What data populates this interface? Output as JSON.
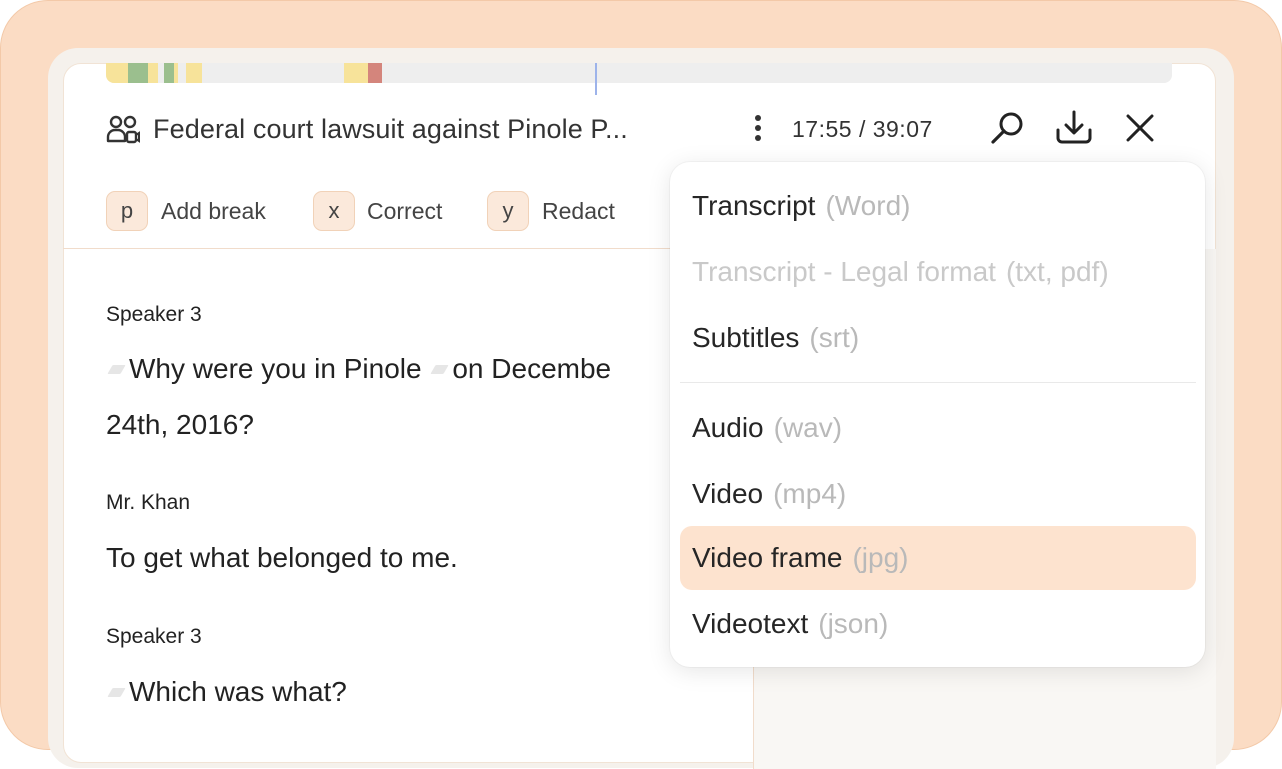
{
  "header": {
    "title": "Federal court lawsuit against Pinole P...",
    "time": "17:55 / 39:07",
    "icons": [
      "people-icon",
      "more-icon",
      "search-icon",
      "download-icon",
      "close-icon"
    ]
  },
  "shortcuts": [
    {
      "key": "p",
      "label": "Add break"
    },
    {
      "key": "x",
      "label": "Correct"
    },
    {
      "key": "y",
      "label": "Redact"
    }
  ],
  "transcript": [
    {
      "speaker": "Speaker 3",
      "lines": [
        "Why were you in Pinole",
        "on Decembe",
        "24th, 2016?"
      ]
    },
    {
      "speaker": "Mr. Khan",
      "lines": [
        "To get what belonged to me."
      ]
    },
    {
      "speaker": "Speaker 3",
      "lines": [
        "Which was what?"
      ]
    }
  ],
  "download_menu": {
    "items": [
      {
        "label": "Transcript",
        "format": "(Word)"
      },
      {
        "label": "Transcript - Legal format",
        "format": "(txt, pdf)",
        "disabled": true
      },
      {
        "label": "Subtitles",
        "format": "(srt)"
      },
      {
        "label": "Audio",
        "format": "(wav)"
      },
      {
        "label": "Video",
        "format": "(mp4)"
      },
      {
        "label": "Video frame",
        "format": "(jpg)",
        "active": true
      },
      {
        "label": "Videotext",
        "format": "(json)"
      }
    ]
  },
  "colors": {
    "accent": "#fde3cf",
    "frame": "#fbdcc4",
    "timeline_yellow": "#f7e39a",
    "timeline_green": "#9bbf8e",
    "timeline_red": "#d4857c",
    "playhead": "#9db3ea"
  }
}
